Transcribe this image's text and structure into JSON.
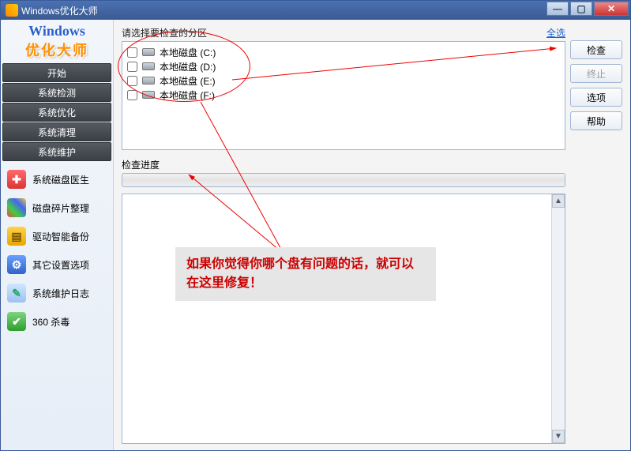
{
  "title": "Windows优化大师",
  "logo": {
    "line1": "Windows",
    "line2": "优化大师"
  },
  "nav": {
    "start": "开始",
    "detect": "系统检测",
    "optimize": "系统优化",
    "clean": "系统清理",
    "maintain": "系统维护"
  },
  "subnav": {
    "disk_doctor": "系统磁盘医生",
    "defrag": "磁盘碎片整理",
    "driver_backup": "驱动智能备份",
    "other_settings": "其它设置选项",
    "maintain_log": "系统维护日志",
    "av360": "360 杀毒"
  },
  "main": {
    "select_label": "请选择要检查的分区",
    "select_all": "全选",
    "drives": [
      {
        "label": "本地磁盘 (C:)"
      },
      {
        "label": "本地磁盘 (D:)"
      },
      {
        "label": "本地磁盘 (E:)"
      },
      {
        "label": "本地磁盘 (F:)"
      }
    ],
    "progress_label": "检查进度"
  },
  "buttons": {
    "check": "检查",
    "stop": "终止",
    "options": "选项",
    "help": "帮助"
  },
  "annotation": {
    "note": "如果你觉得你哪个盘有问题的话，就可以在这里修复！"
  }
}
